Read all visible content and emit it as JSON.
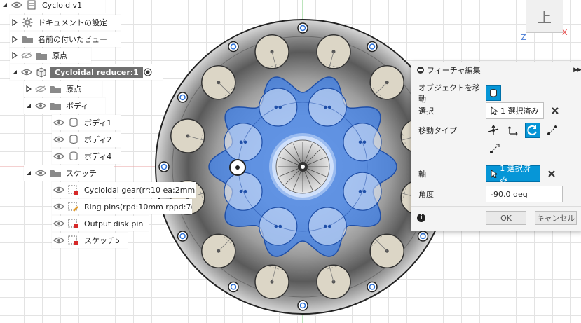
{
  "tree": {
    "root_label": "Cycloid v1",
    "doc_settings": "ドキュメントの設定",
    "named_views": "名前の付いたビュー",
    "origin": "原点",
    "component": "Cycloidal reducer:1",
    "child_origin": "原点",
    "bodies_folder": "ボディ",
    "bodies": [
      "ボディ1",
      "ボディ2",
      "ボディ4"
    ],
    "sketches_folder": "スケッチ",
    "sketches": [
      "Cycloidal gear(rr:10 ea:2mm)",
      "Ring pins(rpd:10mm rppd:7(...",
      "Output disk pin",
      "スケッチ5"
    ]
  },
  "viewcube": {
    "face": "上",
    "x_axis": "X",
    "z_axis": "Z"
  },
  "dialog": {
    "title": "フィーチャ編集",
    "object_label": "オブジェクトを移動",
    "select_label": "選択",
    "select_value": "1 選択済み",
    "move_type_label": "移動タイプ",
    "axis_label": "軸",
    "axis_value": "1 選択済み",
    "angle_label": "角度",
    "angle_value": "-90.0 deg",
    "ok": "OK",
    "cancel": "キャンセル"
  },
  "colors": {
    "accent_blue": "#0696d7",
    "gear_blue": "#3f7fe6",
    "housing_dark": "#3e3e3e",
    "pin_beige": "#dcd6c6"
  }
}
